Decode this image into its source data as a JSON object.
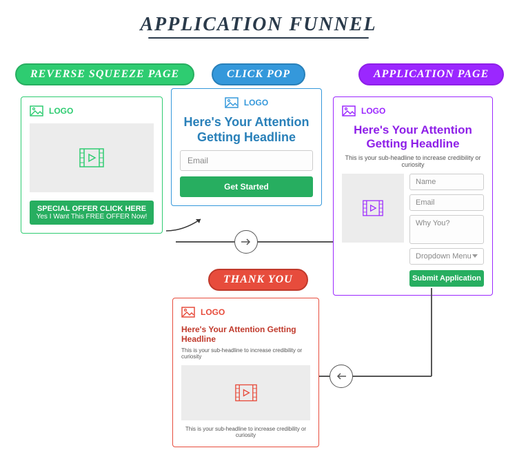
{
  "title": "APPLICATION FUNNEL",
  "pills": {
    "reverse": "REVERSE SQUEEZE PAGE",
    "clickpop": "CLICK POP",
    "application": "APPLICATION PAGE",
    "thankyou": "THANK YOU"
  },
  "logo_label": "LOGO",
  "reverse": {
    "offer_line1": "SPECIAL OFFER CLICK HERE",
    "offer_line2": "Yes I Want This FREE OFFER Now!"
  },
  "clickpop": {
    "headline": "Here's Your Attention Getting Headline",
    "email_placeholder": "Email",
    "button": "Get Started"
  },
  "application": {
    "headline": "Here's Your Attention Getting Headline",
    "subhead": "This is your sub-headline to increase credibility or curiosity",
    "name_placeholder": "Name",
    "email_placeholder": "Email",
    "why_placeholder": "Why You?",
    "dropdown_label": "Dropdown Menu",
    "button": "Submit Application"
  },
  "thankyou": {
    "headline": "Here's Your Attention Getting Headline",
    "subhead_top": "This is your sub-headline to increase credibility or curiosity",
    "subhead_bottom": "This is your sub-headline to increase credibility or curiosity"
  }
}
